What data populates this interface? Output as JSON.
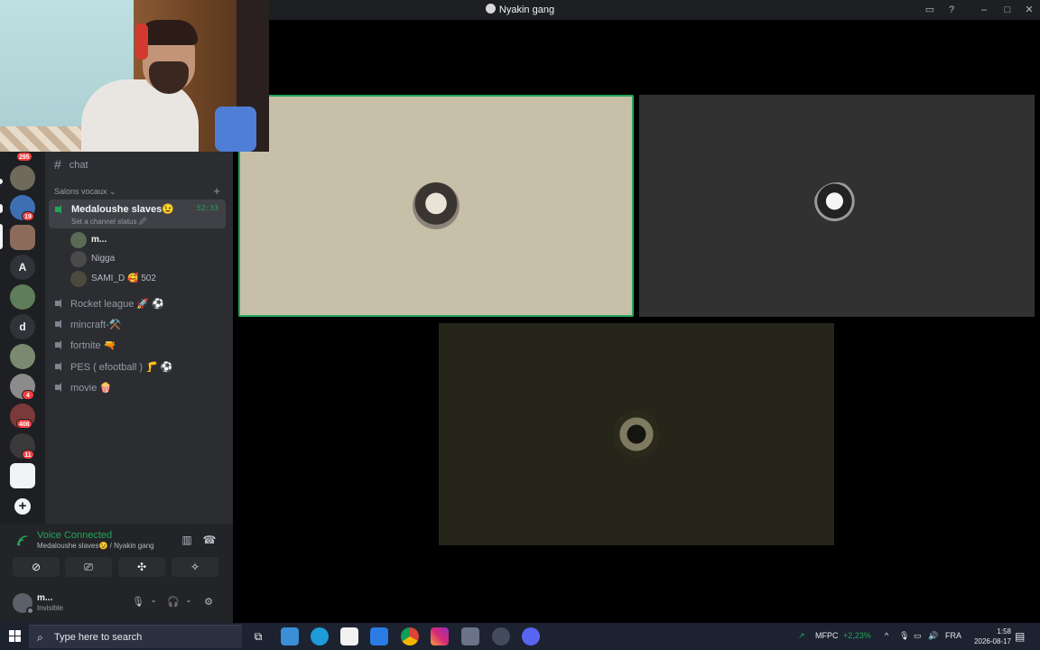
{
  "window": {
    "title": "Nyakin gang"
  },
  "guilds": {
    "badges": [
      "295",
      "19",
      "A",
      "d",
      "4",
      "406",
      "11"
    ]
  },
  "channels": {
    "text_channel": "chat",
    "category": "Salons vocaux",
    "active_voice": {
      "name": "Medaloushe slaves😉",
      "status": "Set a channel status 🖉",
      "timer": "52:33",
      "members": [
        {
          "name": "m...",
          "bold": true
        },
        {
          "name": "Nigga",
          "bold": false
        },
        {
          "name": "SAMI_D  🥰 502",
          "bold": false
        }
      ]
    },
    "voice_channels": [
      "Rocket league 🚀 ⚽",
      "mincraft-⚒️",
      "fortnite 🔫",
      "PES ( efootball ) 🦵 ⚽",
      "movie 🍿"
    ]
  },
  "voice_panel": {
    "title": "Voice Connected",
    "subtitle": "Medaloushe slaves😉 / Nyakin gang"
  },
  "user": {
    "name": "m...",
    "state": "Invisible"
  },
  "taskbar": {
    "search_placeholder": "Type here to search",
    "stock_name": "MFPC",
    "stock_change": "+2,23%",
    "language": "FRA",
    "time": "1:58",
    "date": "2026-08-17"
  },
  "colors": {
    "accent_green": "#23a55a",
    "sidebar": "#2b2d31",
    "rail": "#1e1f22",
    "badge_red": "#f23f42"
  }
}
